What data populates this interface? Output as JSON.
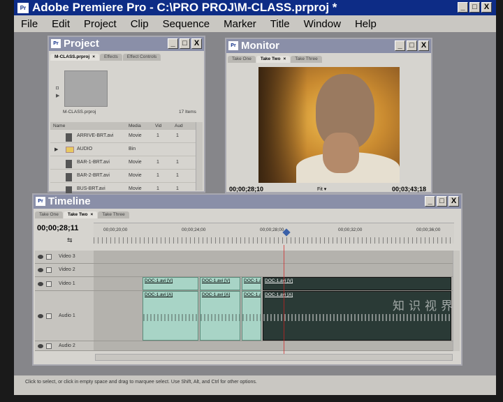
{
  "app": {
    "title": "Adobe Premiere Pro - C:\\PRO PROJ\\M-CLASS.prproj *",
    "icon_text": "Pr"
  },
  "window_buttons": {
    "minimize": "_",
    "restore": "□",
    "close": "X"
  },
  "menu": [
    "File",
    "Edit",
    "Project",
    "Clip",
    "Sequence",
    "Marker",
    "Title",
    "Window",
    "Help"
  ],
  "project": {
    "title": "Project",
    "tabs": [
      "M-CLASS.prproj",
      "Effects",
      "Effect Controls"
    ],
    "active_tab": 0,
    "project_file": "M-CLASS.prproj",
    "item_count": "17 Items",
    "columns": [
      "Name",
      "Media",
      "Vid",
      "Aud"
    ],
    "rows": [
      {
        "name": "ARRIVE-BRT.avi",
        "media": "Movie",
        "vid": "1",
        "aud": "1",
        "kind": "file"
      },
      {
        "name": "AUDIO",
        "media": "Bin",
        "vid": "",
        "aud": "",
        "kind": "bin"
      },
      {
        "name": "BAR-1-BRT.avi",
        "media": "Movie",
        "vid": "1",
        "aud": "1",
        "kind": "file"
      },
      {
        "name": "BAR-2-BRT.avi",
        "media": "Movie",
        "vid": "1",
        "aud": "1",
        "kind": "file"
      },
      {
        "name": "BUS-BRT.avi",
        "media": "Movie",
        "vid": "1",
        "aud": "1",
        "kind": "file"
      }
    ]
  },
  "monitor": {
    "title": "Monitor",
    "tabs": [
      "Take One",
      "Take Two",
      "Take Three"
    ],
    "active_tab": 1,
    "current_time": "00;00;28;10",
    "fit_label": "Fit",
    "duration": "00;03;43;18"
  },
  "timeline": {
    "title": "Timeline",
    "tabs": [
      "Take One",
      "Take Two",
      "Take Three"
    ],
    "active_tab": 1,
    "current_time": "00;00;28;11",
    "ruler_labels": [
      "00;00;20;00",
      "00;00;24;00",
      "00;00;28;00",
      "00;00;32;00",
      "00;00;36;00"
    ],
    "tracks": [
      {
        "name": "Video 3",
        "type": "video",
        "clips": []
      },
      {
        "name": "Video 2",
        "type": "video",
        "clips": []
      },
      {
        "name": "Video 1",
        "type": "video",
        "clips": [
          {
            "label": "DOC-1.avi [V]",
            "selected": false
          },
          {
            "label": "DOC-1.avi [V]",
            "selected": false
          },
          {
            "label": "DOC-1.avi [V]",
            "selected": false
          },
          {
            "label": "DOC-1.avi [V]",
            "selected": true
          }
        ]
      },
      {
        "name": "Audio 1",
        "type": "audio",
        "clips": [
          {
            "label": "DOC-1.avi [A]",
            "selected": false
          },
          {
            "label": "DOC-1.avi [A]",
            "selected": false
          },
          {
            "label": "DOC-1.avi [A]",
            "selected": false
          },
          {
            "label": "DOC-1.avi [A]",
            "selected": true
          }
        ]
      },
      {
        "name": "Audio 2",
        "type": "audio",
        "clips": []
      }
    ]
  },
  "watermark": "知识视界",
  "status": "Click to select, or click in empty space and drag to marquee select. Use Shift, Alt, and Ctrl for other options."
}
